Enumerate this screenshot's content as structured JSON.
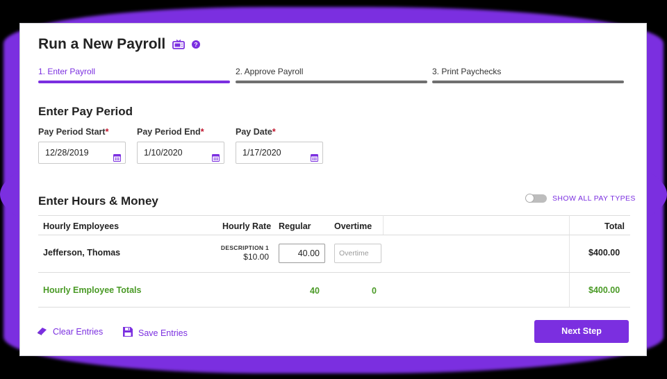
{
  "page": {
    "title": "Run a New Payroll",
    "icons": {
      "video": "tv-icon",
      "help": "help-icon"
    }
  },
  "steps": [
    {
      "label": "1. Enter Payroll",
      "active": true
    },
    {
      "label": "2. Approve Payroll",
      "active": false
    },
    {
      "label": "3. Print Paychecks",
      "active": false
    }
  ],
  "pay_period": {
    "section_title": "Enter Pay Period",
    "required_marker": "*",
    "fields": [
      {
        "label": "Pay Period Start",
        "value": "12/28/2019"
      },
      {
        "label": "Pay Period End",
        "value": "1/10/2020"
      },
      {
        "label": "Pay Date",
        "value": "1/17/2020"
      }
    ]
  },
  "hours_money": {
    "section_title": "Enter Hours & Money",
    "toggle_label": "SHOW ALL PAY TYPES",
    "toggle_on": false,
    "columns": {
      "employees": "Hourly Employees",
      "rate": "Hourly Rate",
      "regular": "Regular",
      "overtime": "Overtime",
      "total": "Total"
    },
    "rows": [
      {
        "name": "Jefferson, Thomas",
        "description": "DESCRIPTION 1",
        "rate": "$10.00",
        "regular": "40.00",
        "overtime_placeholder": "Overtime",
        "total": "$400.00"
      }
    ],
    "totals": {
      "label": "Hourly Employee Totals",
      "regular": "40",
      "overtime": "0",
      "total": "$400.00"
    }
  },
  "footer": {
    "clear_label": "Clear Entries",
    "save_label": "Save Entries",
    "next_label": "Next Step"
  },
  "colors": {
    "accent": "#7b2fe0",
    "green": "#4a9a26",
    "required": "#c0142c"
  }
}
